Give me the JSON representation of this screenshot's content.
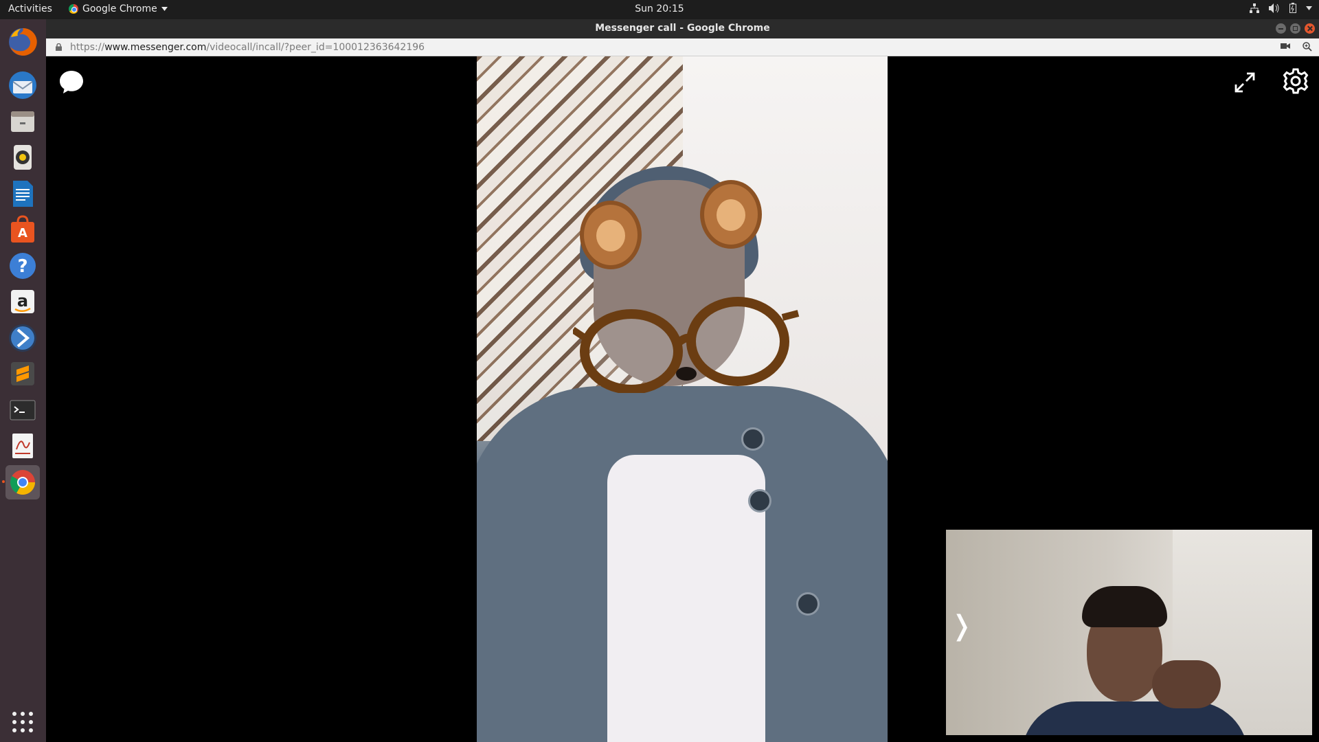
{
  "topbar": {
    "activities": "Activities",
    "app_name": "Google Chrome",
    "clock": "Sun 20:15"
  },
  "window": {
    "title": "Messenger call - Google Chrome"
  },
  "address_bar": {
    "url_scheme": "https://",
    "url_host": "www.messenger.com",
    "url_path": "/videocall/incall/?peer_id=100012363642196"
  },
  "dock": {
    "items": [
      {
        "name": "firefox",
        "icon": "firefox-icon"
      },
      {
        "name": "thunderbird",
        "icon": "thunderbird-icon"
      },
      {
        "name": "files",
        "icon": "files-icon"
      },
      {
        "name": "rhythmbox",
        "icon": "rhythmbox-icon"
      },
      {
        "name": "libreoffice-writer",
        "icon": "writer-icon"
      },
      {
        "name": "ubuntu-software",
        "icon": "software-icon"
      },
      {
        "name": "help",
        "icon": "help-icon"
      },
      {
        "name": "amazon",
        "icon": "amazon-icon"
      },
      {
        "name": "app-k",
        "icon": "blue-k-icon"
      },
      {
        "name": "sublime-text",
        "icon": "sublime-icon"
      },
      {
        "name": "terminal",
        "icon": "terminal-icon"
      },
      {
        "name": "pdf-viewer",
        "icon": "pdf-icon"
      },
      {
        "name": "google-chrome",
        "icon": "chrome-icon",
        "active": true
      }
    ],
    "show_apps": "app-grid-icon"
  },
  "call": {
    "chat_icon": "chat-bubble-icon",
    "expand_icon": "fullscreen-icon",
    "settings_icon": "gear-icon",
    "self_view_toggle": "❭"
  },
  "colors": {
    "topbar_bg": "#1d1d1d",
    "dock_bg": "#3b2f36",
    "call_bg": "#000000"
  }
}
